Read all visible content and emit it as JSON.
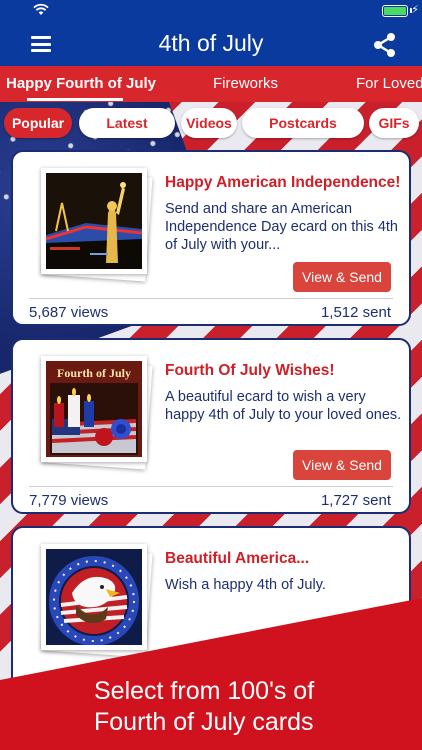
{
  "nav": {
    "title": "4th of July"
  },
  "categories": [
    "Happy Fourth of July",
    "Fireworks",
    "For Loved"
  ],
  "filters": [
    "Popular",
    "Latest",
    "Videos",
    "Postcards",
    "GIFs"
  ],
  "cards": [
    {
      "title": "Happy American Independence!",
      "description": "Send and share an American Independence Day ecard on this 4th of July with your...",
      "button": "View & Send",
      "views": "5,687 views",
      "sent": "1,512 sent"
    },
    {
      "title": "Fourth Of July Wishes!",
      "description": "A beautiful ecard to wish a very happy 4th of July to your loved ones.",
      "button": "View & Send",
      "views": "7,779 views",
      "sent": "1,727 sent",
      "thumb_text": "Fourth of July"
    },
    {
      "title": "Beautiful America...",
      "description": "Wish a happy 4th of July."
    }
  ],
  "banner": {
    "line1": "Select from 100's of",
    "line2": "Fourth of July cards"
  },
  "colors": {
    "navy": "#0b3a9e",
    "red": "#d8262d",
    "card_border": "#1b2c72",
    "text_blue": "#1d2f70"
  }
}
